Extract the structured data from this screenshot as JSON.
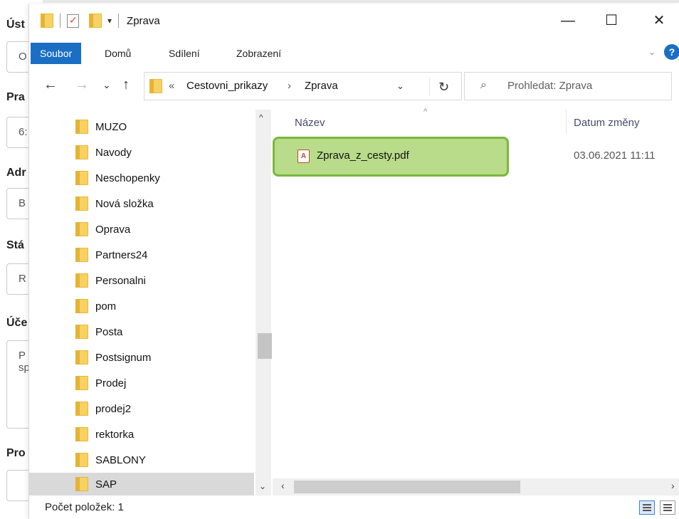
{
  "background_form": {
    "labels": [
      "Úst",
      "Pra",
      "Adr",
      "Stá",
      "Úče",
      "Pro"
    ],
    "inputs": [
      "O",
      "6:",
      "B",
      "R",
      "P\nsp",
      ""
    ]
  },
  "window": {
    "title": "Zprava",
    "controls": {
      "minimize": "—",
      "maximize": "☐",
      "close": "✕"
    }
  },
  "ribbon": {
    "tabs": [
      "Soubor",
      "Domů",
      "Sdílení",
      "Zobrazení"
    ],
    "help": "?"
  },
  "navigation": {
    "back": "←",
    "forward": "→",
    "recent": "⌄",
    "up": "↑",
    "address": {
      "overflow": "«",
      "segments": [
        "Cestovni_prikazy",
        "Zprava"
      ],
      "separator": "›"
    },
    "refresh": "↻",
    "search_placeholder": "Prohledat: Zprava"
  },
  "tree": {
    "items": [
      "MUZO",
      "Navody",
      "Neschopenky",
      "Nová složka",
      "Oprava",
      "Partners24",
      "Personalni",
      "pom",
      "Posta",
      "Postsignum",
      "Prodej",
      "prodej2",
      "rektorka",
      "SABLONY",
      "SAP"
    ],
    "selected": "SAP"
  },
  "filelist": {
    "columns": {
      "name": "Název",
      "date": "Datum změny"
    },
    "files": [
      {
        "name": "Zprava_z_cesty.pdf",
        "date": "03.06.2021 11:11",
        "icon": "pdf-icon"
      }
    ],
    "highlight_color": "#b8dc8a"
  },
  "status": {
    "count_text": "Počet položek: 1"
  }
}
